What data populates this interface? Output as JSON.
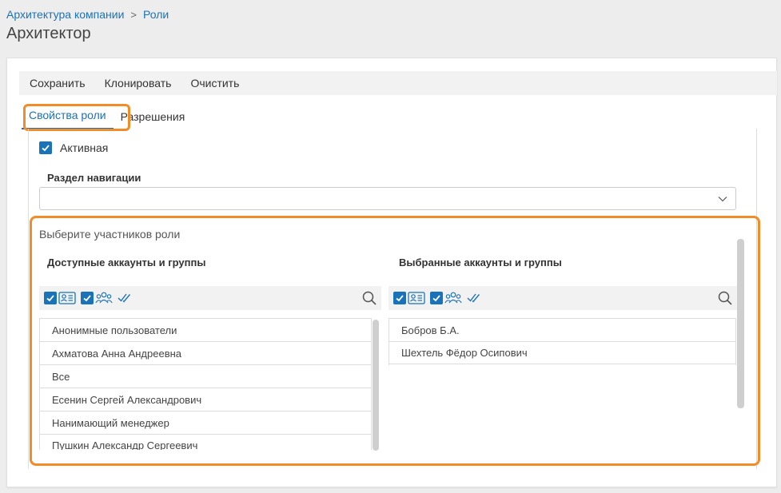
{
  "breadcrumb": {
    "items": [
      "Архитектура компании",
      "Роли"
    ],
    "separator": ">"
  },
  "page_title": "Архитектор",
  "toolbar": {
    "save": "Сохранить",
    "clone": "Клонировать",
    "clear": "Очистить"
  },
  "tabs": [
    {
      "label": "Свойства роли",
      "active": true
    },
    {
      "label": "Разрешения",
      "active": false
    }
  ],
  "active_checkbox": {
    "label": "Активная",
    "checked": true
  },
  "nav_section": {
    "label": "Раздел навигации",
    "value": ""
  },
  "members": {
    "title": "Выберите участников роли",
    "available": {
      "title": "Доступные аккаунты и группы",
      "items": [
        "Анонимные пользователи",
        "Ахматова Анна Андреевна",
        "Все",
        "Есенин Сергей Александрович",
        "Нанимающий менеджер",
        "Пушкин Александр Сергеевич"
      ]
    },
    "selected": {
      "title": "Выбранные аккаунты и группы",
      "items": [
        "Бобров Б.А.",
        "Шехтель Фёдор Осипович"
      ]
    }
  },
  "colors": {
    "accent": "#1a73b8",
    "highlight": "#f28c28"
  }
}
